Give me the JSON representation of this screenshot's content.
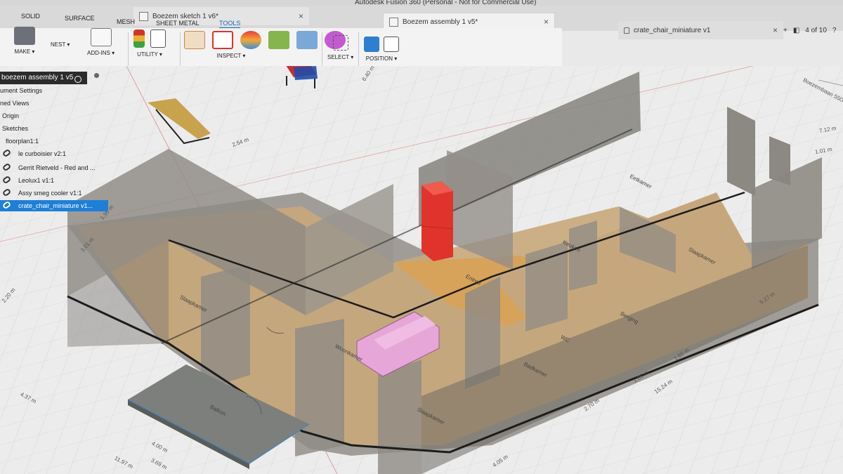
{
  "app": {
    "title": "Autodesk Fusion 360 (Personal - Not for Commercial Use)"
  },
  "doc_tabs": [
    {
      "label": "Boezem sketch 1 v6*"
    },
    {
      "label": "Boezem assembly 1 v5*"
    },
    {
      "label": "crate_chair_miniature v1"
    }
  ],
  "tab_tools": {
    "page_counter": "4 of 10"
  },
  "ribbon": {
    "tabs": [
      "SOLID",
      "SURFACE",
      "MESH",
      "SHEET METAL",
      "TOOLS"
    ],
    "active_tab": "TOOLS",
    "groups": {
      "make": "MAKE ▾",
      "nest": "NEST ▾",
      "addins": "ADD-INS ▾",
      "utility": "UTILITY ▾",
      "inspect": "INSPECT ▾",
      "select": "SELECT ▾",
      "position": "POSITION ▾"
    }
  },
  "browser": {
    "root": "boezem assembly 1 v5",
    "items": [
      "ument Settings",
      "ned Views",
      "Origin",
      "Sketches",
      "floorplan1:1"
    ],
    "links": [
      "le curboisier v2:1",
      "Gerrit Rietveld - Red and ...",
      "Leolux1 v1:1",
      "Assy smeg cooler v1:1",
      "crate_chair_miniature v1..."
    ],
    "selected_link": "crate_chair_miniature v1..."
  },
  "rooms": [
    "Eetkamer",
    "Keuken",
    "Slaapkamer",
    "Entree",
    "Slaapkamer",
    "Berging",
    "Woonkamer",
    "WC",
    "Badkamer",
    "Slaapkamer",
    "Balkon"
  ],
  "dimensions": [
    "6.40 m",
    "2.54 m",
    "1.95 m",
    "3.01 m",
    "2.20 m",
    "4.37 m",
    "4.00 m",
    "3.69 m",
    "11.97 m",
    "1.01 m",
    "7.12 m",
    "5.27 m",
    "1.65 m",
    "1.05 m",
    "15.24 m",
    "2.70 m",
    "4.05 m"
  ],
  "viewcube": {
    "label": "Boezembaan 55G"
  },
  "colors": {
    "floor": "#c9a87a",
    "entree_floor": "#d7a25a",
    "wall": "#8e8a84",
    "fridge": "#e0332b",
    "sofa": "#e6a6d8",
    "balcony": "#7d7f7c",
    "selection": "#1f7fd6"
  }
}
